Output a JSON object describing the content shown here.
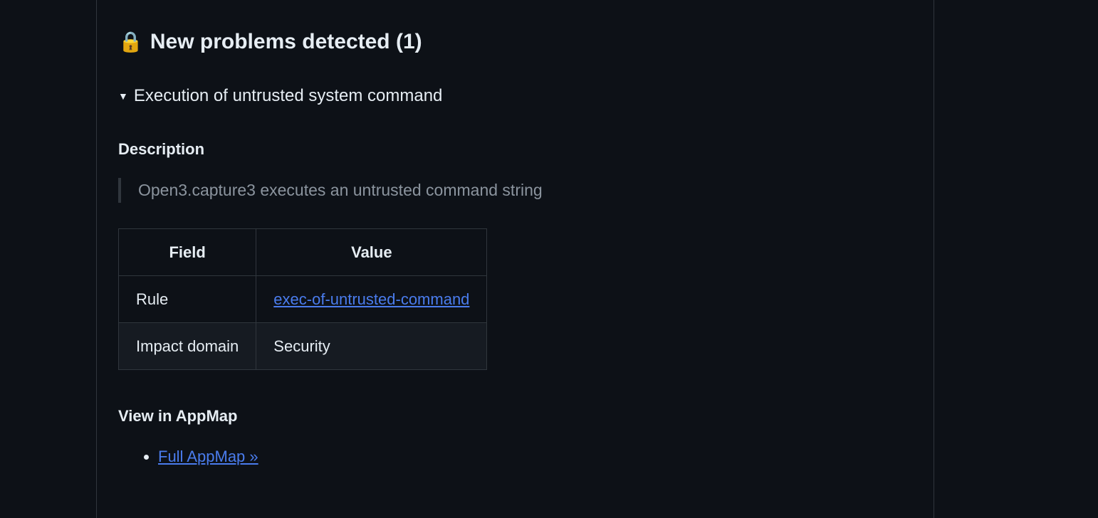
{
  "heading": {
    "icon": "🔒",
    "text": "New problems detected (1)"
  },
  "summary": {
    "text": "Execution of untrusted system command"
  },
  "description": {
    "label": "Description",
    "text": "Open3.capture3 executes an untrusted command string"
  },
  "table": {
    "headers": {
      "field": "Field",
      "value": "Value"
    },
    "rows": [
      {
        "field": "Rule",
        "value": "exec-of-untrusted-command",
        "is_link": true
      },
      {
        "field": "Impact domain",
        "value": "Security",
        "is_link": false
      }
    ]
  },
  "view": {
    "label": "View in AppMap",
    "link_text": "Full AppMap »"
  }
}
